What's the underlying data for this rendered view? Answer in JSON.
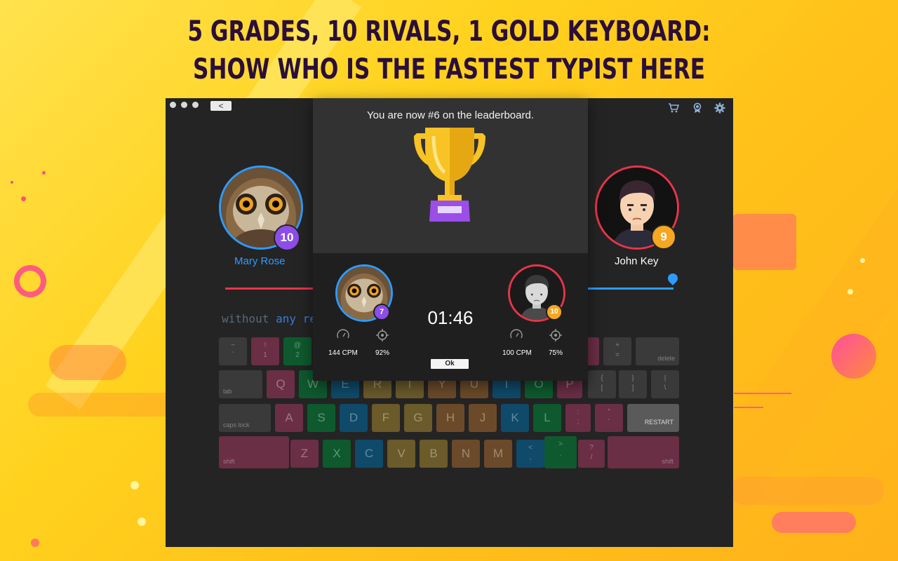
{
  "headline": {
    "line1": "5 GRADES, 10 RIVALS, 1 GOLD KEYBOARD:",
    "line2": "SHOW WHO IS THE FASTEST TYPIST HERE"
  },
  "window": {
    "back_label": "<",
    "icons": [
      "cart-icon",
      "award-icon",
      "gear-icon"
    ]
  },
  "players": {
    "left": {
      "name": "Mary Rose",
      "grade": "10",
      "avatar": "owl-avatar"
    },
    "right": {
      "name": "John Key",
      "grade": "9",
      "avatar": "man-avatar"
    }
  },
  "typing": {
    "done": "without",
    "current": "any re"
  },
  "keyboard": {
    "row1": [
      "~",
      "!",
      "@",
      "",
      "",
      "",
      "",
      "",
      "",
      "",
      "",
      "",
      "+",
      "delete"
    ],
    "row1_sub": [
      "`",
      "1",
      "2",
      "",
      "",
      "",
      "",
      "",
      "",
      "",
      "",
      "",
      "="
    ],
    "row2": [
      "tab",
      "Q",
      "W",
      "E",
      "R",
      "T",
      "Y",
      "U",
      "I",
      "O",
      "P",
      "{",
      "}",
      "|"
    ],
    "row2_sub": [
      "",
      "",
      "",
      "",
      "",
      "",
      "",
      "",
      "",
      "",
      "",
      "[",
      "]",
      "\\"
    ],
    "row3": [
      "caps lock",
      "A",
      "S",
      "D",
      "F",
      "G",
      "H",
      "J",
      "K",
      "L",
      ":",
      "\"",
      "RESTART"
    ],
    "row3_sub": [
      "",
      "",
      "",
      "",
      "",
      "",
      "",
      "",
      "",
      "",
      ";",
      "'"
    ],
    "row4": [
      "shift",
      "Z",
      "X",
      "C",
      "V",
      "B",
      "N",
      "M",
      "<",
      ">",
      "?",
      "shift"
    ],
    "row4_sub": [
      "",
      "",
      "",
      "",
      "",
      "",
      "",
      "",
      ",",
      ".",
      "/"
    ]
  },
  "result": {
    "message": "You are now #6 on the leaderboard.",
    "timer": "01:46",
    "left": {
      "grade": "7",
      "cpm": "144 CPM",
      "accuracy": "92%"
    },
    "right": {
      "grade": "10",
      "cpm": "100 CPM",
      "accuracy": "75%"
    },
    "ok_label": "Ok"
  },
  "colors": {
    "accent_blue": "#2e9bff",
    "accent_red": "#e8344a",
    "badge_purple": "#8c4de8",
    "badge_orange": "#f5a623",
    "trophy_gold": "#f7c325",
    "trophy_purple": "#9b4ee8"
  }
}
